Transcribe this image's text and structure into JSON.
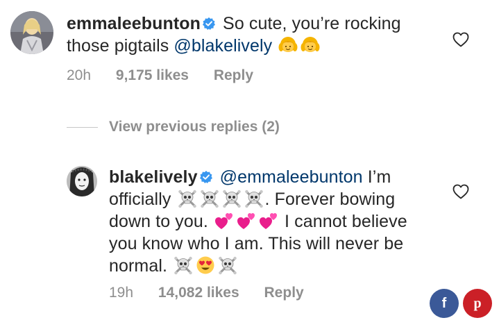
{
  "comment1": {
    "username": "emmaleebunton",
    "text_before_mention": "So cute, you’re rocking those pigtails ",
    "mention": "@blakelively",
    "emojis": [
      "girl-blonde-emoji",
      "girl-blonde-emoji"
    ],
    "time": "20h",
    "likes": "9,175 likes",
    "reply_label": "Reply"
  },
  "view_previous": {
    "label": "View previous replies (2)"
  },
  "comment2": {
    "username": "blakelively",
    "mention": "@emmaleebunton",
    "text_part1": " I’m officially ",
    "emojis_part1": [
      "skull-crossbones-emoji",
      "skull-crossbones-emoji",
      "skull-crossbones-emoji",
      "skull-crossbones-emoji"
    ],
    "text_part2": ". Forever bowing down to you. ",
    "emojis_part2": [
      "two-hearts-emoji",
      "two-hearts-emoji",
      "two-hearts-emoji"
    ],
    "text_part3": " I cannot believe you know who I am. This will never be normal. ",
    "emojis_part3": [
      "skull-crossbones-emoji",
      "heart-eyes-emoji",
      "skull-crossbones-emoji"
    ],
    "time": "19h",
    "likes": "14,082 likes",
    "reply_label": "Reply"
  },
  "share": {
    "facebook": "f",
    "pinterest": "p"
  },
  "colors": {
    "text": "#262626",
    "meta": "#8e8e8e",
    "mention": "#00376b",
    "verified": "#3897f0",
    "facebook": "#3b5998",
    "pinterest": "#cb2027"
  }
}
